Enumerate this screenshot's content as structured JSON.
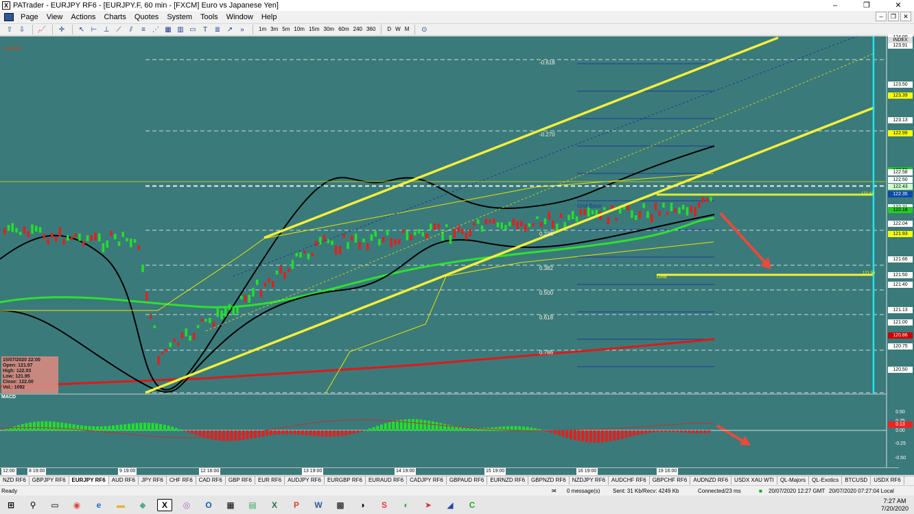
{
  "window": {
    "title": "PATrader - EURJPY RF6 - [EURJPY.F, 60 min - [FXCM] Euro vs Japanese Yen]",
    "min": "–",
    "max": "❐",
    "close": "✕"
  },
  "menu": [
    "Page",
    "View",
    "Actions",
    "Charts",
    "Quotes",
    "System",
    "Tools",
    "Window",
    "Help"
  ],
  "toolbar": {
    "timeframes": [
      "1m",
      "3m",
      "5m",
      "10m",
      "15m",
      "30m",
      "60m",
      "240",
      "360"
    ],
    "periods": [
      "D",
      "W",
      "M"
    ]
  },
  "chart": {
    "locked_label": "Locked",
    "ohlc": {
      "date": "15/07/2020 22:00",
      "open": "Open: 121.97",
      "high": "High: 122.03",
      "low": "Low: 121.95",
      "close": "Close: 122.00",
      "vol": "Vol.: 1092"
    },
    "index_label": "INDEX",
    "price_labels": [
      "124.00",
      "123.91",
      "123.50",
      "123.39",
      "123.13",
      "122.99",
      "122.60",
      "122.58",
      "122.50",
      "122.43",
      "122.35",
      "122.21",
      "122.18",
      "122.04",
      "121.93",
      "121.66",
      "121.50",
      "121.40",
      "121.13",
      "121.00",
      "120.86",
      "120.75",
      "120.50"
    ],
    "fib_labels": [
      "-0.618",
      "-0.270",
      "0.236",
      "0.382",
      "0.500",
      "0.618",
      "0.786"
    ],
    "grid_base": "Grid Base",
    "limit": "Limit",
    "macd_label": "MACD",
    "macd_axis": [
      "0.50",
      "0.25",
      "0.13",
      "0.00",
      "-0.25",
      "-0.50"
    ],
    "time_labels": [
      "12:00",
      "8 19:00",
      "9 19:00",
      "12 16:00",
      "13 19:00",
      "14 19:00",
      "15 19:00",
      "16 19:00",
      "19 16:00"
    ],
    "right_line_labels": [
      "122.43",
      "121.56"
    ]
  },
  "tabs": [
    "NZD RF6",
    "GBPJPY RF6",
    "EURJPY RF6",
    "AUD RF6",
    "JPY RF6",
    "CHF RF6",
    "CAD RF6",
    "GBP RF6",
    "EUR RF6",
    "AUDJPY RF6",
    "EURGBP RF6",
    "EURAUD RF6",
    "CADJPY RF6",
    "GBPAUD RF6",
    "EURNZD RF6",
    "GBPNZD RF6",
    "NZDJPY RF6",
    "AUDCHF RF6",
    "GBPCHF RF6",
    "AUDNZD RF6",
    "USDX XAU WTI",
    "QL-Majors",
    "QL-Exotics",
    "BTCUSD",
    "USDX RF6"
  ],
  "active_tab": "EURJPY RF6",
  "status": {
    "ready": "Ready",
    "messages": "0 message(s)",
    "sent": "Sent: 31 Kb/Recv: 4249 Kb",
    "connected": "Connected/23 ms",
    "time": "20/07/2020 12:27 GMT",
    "local": "20/07/2020 07:27:04 Local"
  },
  "clock": {
    "time": "7:27 AM",
    "date": "7/20/2020"
  },
  "colors": {
    "chart_bg": "#3b7a7a",
    "channel": "#f5f03a",
    "bull": "#22e02a",
    "bear": "#e02020"
  }
}
